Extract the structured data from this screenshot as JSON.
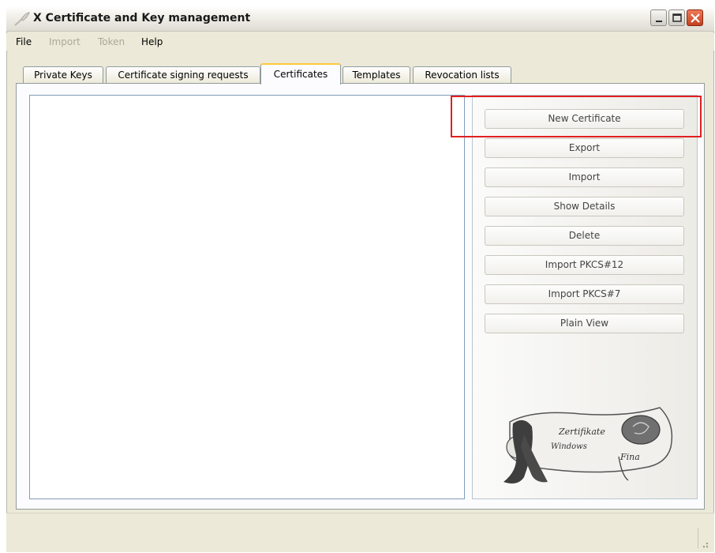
{
  "window": {
    "title": "X Certificate and Key management"
  },
  "menu": [
    {
      "label": "File",
      "enabled": true
    },
    {
      "label": "Import",
      "enabled": false
    },
    {
      "label": "Token",
      "enabled": false
    },
    {
      "label": "Help",
      "enabled": true
    }
  ],
  "tabs": [
    {
      "label": "Private Keys",
      "active": false
    },
    {
      "label": "Certificate signing requests",
      "active": false
    },
    {
      "label": "Certificates",
      "active": true
    },
    {
      "label": "Templates",
      "active": false
    },
    {
      "label": "Revocation lists",
      "active": false
    }
  ],
  "actions": [
    {
      "label": "New Certificate"
    },
    {
      "label": "Export"
    },
    {
      "label": "Import"
    },
    {
      "label": "Show Details"
    },
    {
      "label": "Delete"
    },
    {
      "label": "Import PKCS#12"
    },
    {
      "label": "Import PKCS#7"
    },
    {
      "label": "Plain View"
    }
  ],
  "logo": {
    "line1": "Zertifikate",
    "line2": "Windows",
    "line3": "Fina"
  },
  "colors": {
    "highlight": "#e02020",
    "active_tab_accent": "#ffc83c",
    "close_button": "#c2401f"
  }
}
